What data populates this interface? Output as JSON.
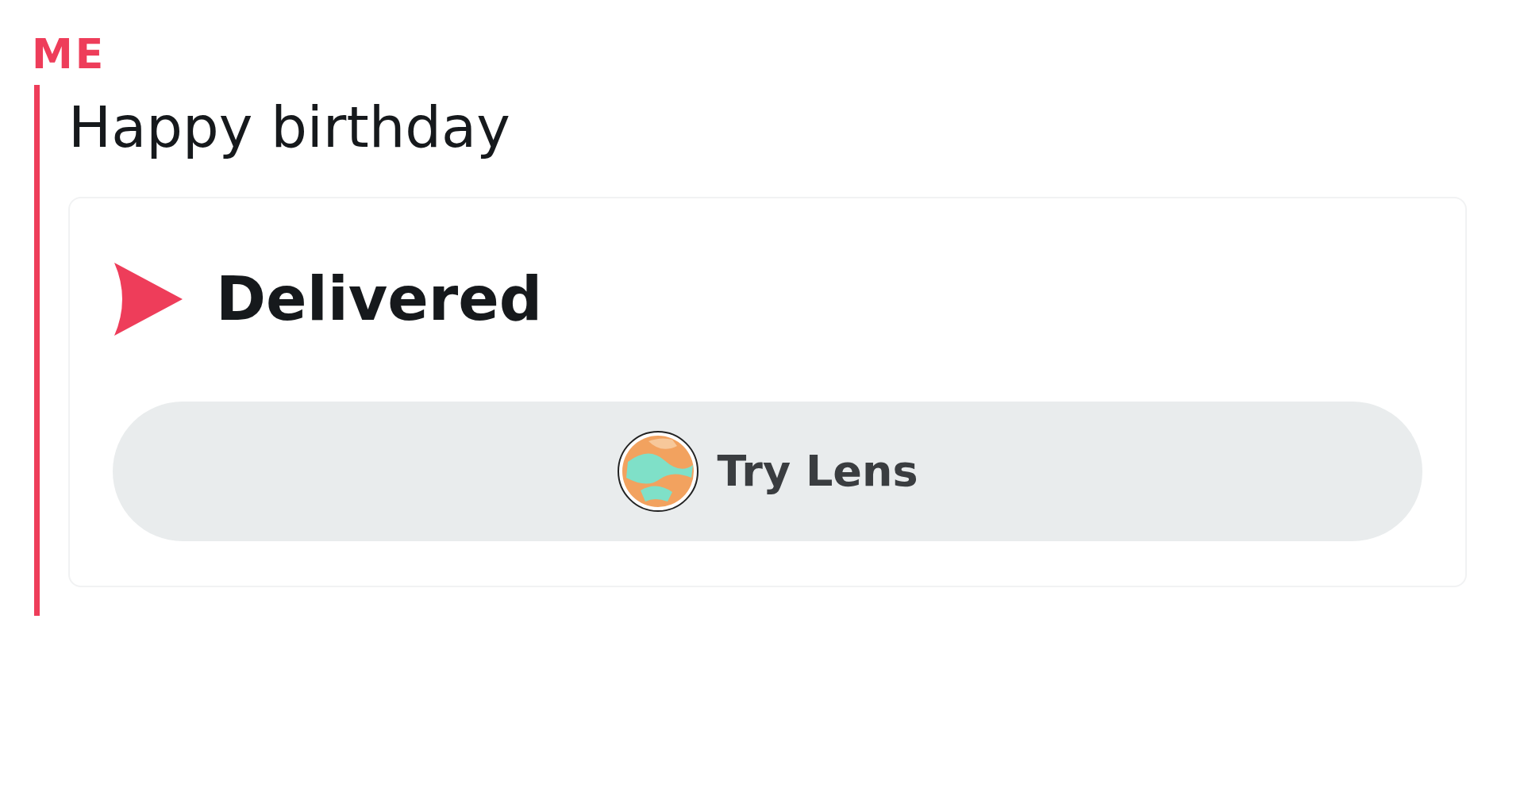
{
  "sender": "ME",
  "message": "Happy birthday",
  "status": {
    "kind": "delivered",
    "label": "Delivered"
  },
  "action_button": {
    "label": "Try Lens"
  }
}
